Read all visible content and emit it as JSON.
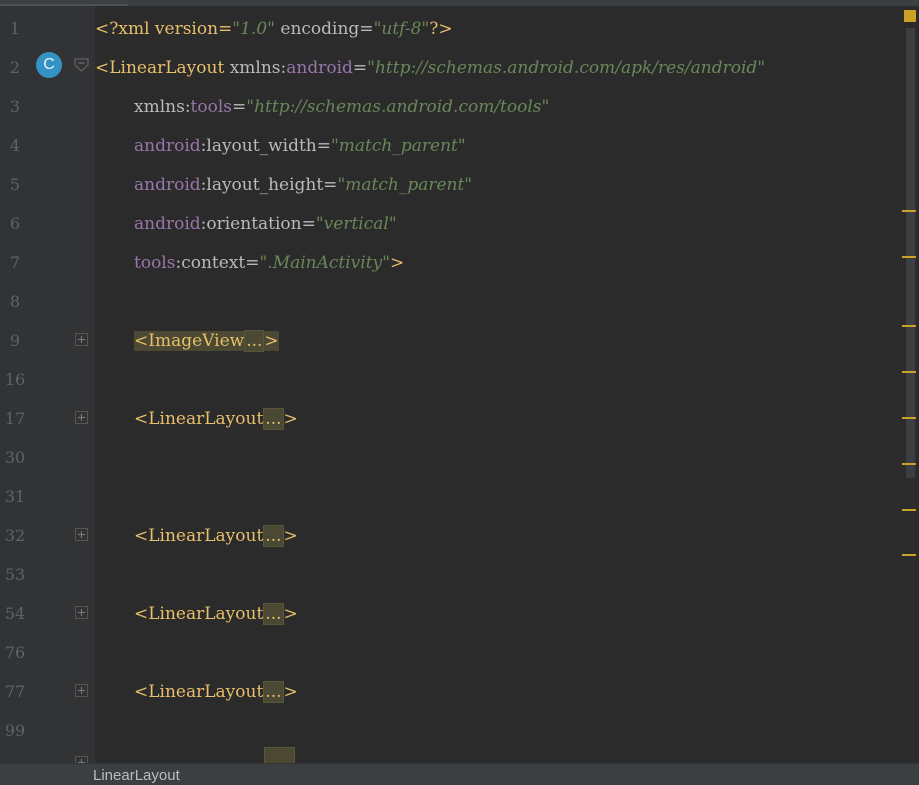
{
  "line_numbers": [
    "1",
    "2",
    "3",
    "4",
    "5",
    "6",
    "7",
    "8",
    "9",
    "16",
    "17",
    "30",
    "31",
    "32",
    "53",
    "54",
    "76",
    "77",
    "99"
  ],
  "gutter_badge": "C",
  "code": {
    "l1": {
      "lt": "<?xml version=",
      "ver": "\"1.0\"",
      "enc": " encoding=",
      "encval": "\"utf-8\"",
      "close": "?>"
    },
    "l2": {
      "tag": "<LinearLayout",
      "attr": " xmlns:",
      "ns": "android",
      "eq": "=",
      "val": "\"http://schemas.android.com/apk/res/android\""
    },
    "l3": {
      "attr": "xmlns:",
      "ns": "tools",
      "eq": "=",
      "val": "\"http://schemas.android.com/tools\""
    },
    "l4": {
      "ns": "android",
      "attr": ":layout_width=",
      "val": "\"match_parent\""
    },
    "l5": {
      "ns": "android",
      "attr": ":layout_height=",
      "val": "\"match_parent\""
    },
    "l6": {
      "ns": "android",
      "attr": ":orientation=",
      "val": "\"vertical\""
    },
    "l7": {
      "ns": "tools",
      "attr": ":context=",
      "val": "\".MainActivity\"",
      "close": ">"
    },
    "l9": {
      "tag": "<ImageView",
      "ellip": "...",
      "close": ">"
    },
    "l17": {
      "tag": "<LinearLayout",
      "ellip": "...",
      "close": ">"
    },
    "l32": {
      "tag": "<LinearLayout",
      "ellip": "...",
      "close": ">"
    },
    "l54": {
      "tag": "<LinearLayout",
      "ellip": "...",
      "close": ">"
    },
    "l77": {
      "tag": "<LinearLayout",
      "ellip": "...",
      "close": ">"
    }
  },
  "status": {
    "breadcrumb": "LinearLayout"
  },
  "colors": {
    "background": "#2b2b2b",
    "gutter": "#313335",
    "tag": "#e8bf6a",
    "string": "#6a8759",
    "namespace": "#9876aa",
    "warning": "#c9a227",
    "badge": "#3592c4"
  }
}
